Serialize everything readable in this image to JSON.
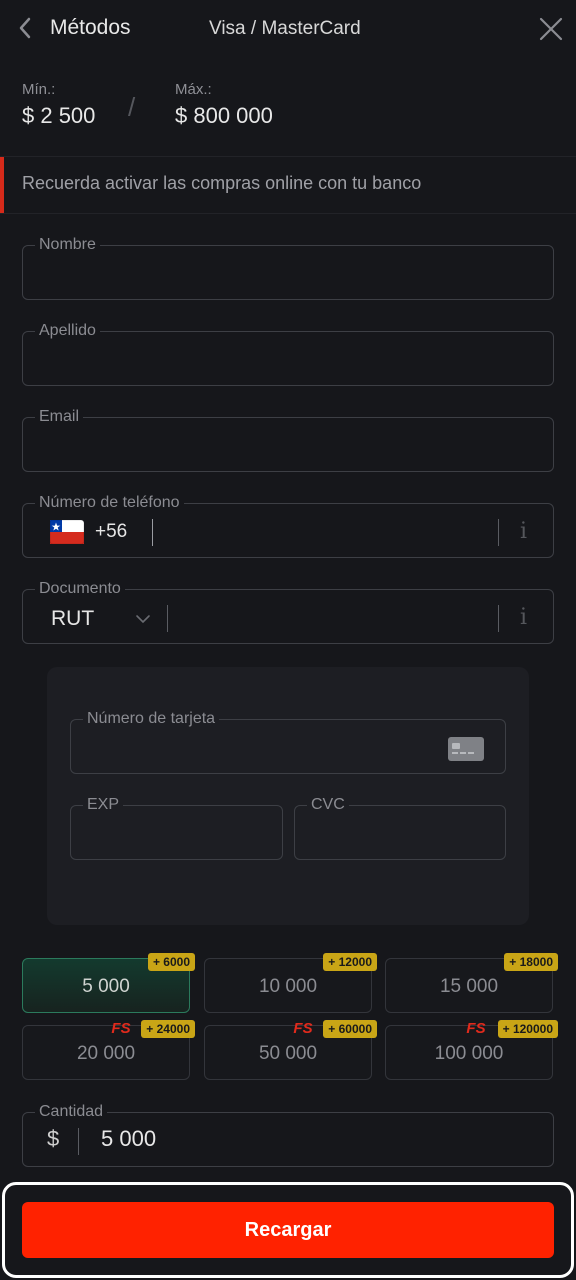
{
  "header": {
    "title": "Métodos",
    "method_name": "Visa / MasterCard"
  },
  "limits": {
    "min_label": "Mín.:",
    "min_value": "$ 2 500",
    "separator": "/",
    "max_label": "Máx.:",
    "max_value": "$ 800 000"
  },
  "notice": {
    "text": "Recuerda activar las compras online con tu banco",
    "accent_color": "#d62a1a"
  },
  "form": {
    "first_name_label": "Nombre",
    "last_name_label": "Apellido",
    "email_label": "Email",
    "phone_label": "Número de teléfono",
    "phone_prefix": "+56",
    "phone_flag": "chile-flag-icon",
    "document_label": "Documento",
    "document_type": "RUT",
    "info_icon": "i"
  },
  "card": {
    "number_label": "Número de tarjeta",
    "exp_label": "EXP",
    "cvc_label": "CVC"
  },
  "amounts": {
    "options": [
      {
        "value": "5 000",
        "bonus": "+ 6000",
        "fs": false,
        "selected": true
      },
      {
        "value": "10 000",
        "bonus": "+ 12000",
        "fs": false,
        "selected": false
      },
      {
        "value": "15 000",
        "bonus": "+ 18000",
        "fs": false,
        "selected": false
      },
      {
        "value": "20 000",
        "bonus": "+ 24000",
        "fs": true,
        "selected": false
      },
      {
        "value": "50 000",
        "bonus": "+ 60000",
        "fs": true,
        "selected": false
      },
      {
        "value": "100 000",
        "bonus": "+ 120000",
        "fs": true,
        "selected": false
      }
    ],
    "fs_text": "FS",
    "badge_color": "#c9a516",
    "selected_color": "#2b7a5c"
  },
  "quantity": {
    "label": "Cantidad",
    "currency": "$",
    "value": "5 000"
  },
  "submit": {
    "label": "Recargar",
    "color": "#ff2200"
  }
}
